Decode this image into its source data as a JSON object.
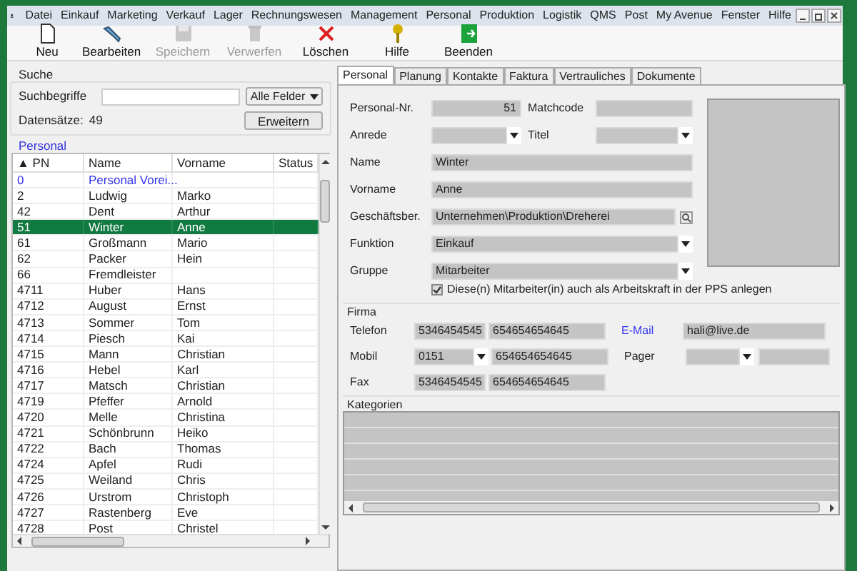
{
  "menu": [
    "Datei",
    "Einkauf",
    "Marketing",
    "Verkauf",
    "Lager",
    "Rechnungswesen",
    "Management",
    "Personal",
    "Produktion",
    "Logistik",
    "QMS",
    "Post",
    "My Avenue",
    "Fenster",
    "Hilfe"
  ],
  "toolbar": [
    {
      "label": "Neu",
      "kind": "new",
      "disabled": false
    },
    {
      "label": "Bearbeiten",
      "kind": "edit",
      "disabled": false
    },
    {
      "label": "Speichern",
      "kind": "save",
      "disabled": true
    },
    {
      "label": "Verwerfen",
      "kind": "discard",
      "disabled": true
    },
    {
      "label": "Löschen",
      "kind": "delete",
      "disabled": false
    },
    {
      "label": "Hilfe",
      "kind": "help",
      "disabled": false
    },
    {
      "label": "Beenden",
      "kind": "exit",
      "disabled": false
    }
  ],
  "search": {
    "title": "Suche",
    "label": "Suchbegriffe",
    "scope": "Alle Felder",
    "count_label": "Datensätze:",
    "count": "49",
    "button": "Erweitern"
  },
  "personal": {
    "title": "Personal",
    "columns": [
      "▲ PN",
      "Name",
      "Vorname",
      "Status"
    ],
    "rows": [
      {
        "cells": [
          "0",
          "Personal Vorei...",
          ""
        ],
        "kind": "template",
        "selected": false
      },
      {
        "cells": [
          "2",
          "Ludwig",
          "Marko"
        ],
        "kind": "person",
        "selected": false
      },
      {
        "cells": [
          "42",
          "Dent",
          "Arthur"
        ],
        "kind": "person",
        "selected": false
      },
      {
        "cells": [
          "51",
          "Winter",
          "Anne"
        ],
        "kind": "person",
        "selected": true
      },
      {
        "cells": [
          "61",
          "Großmann",
          "Mario"
        ],
        "kind": "person",
        "selected": false
      },
      {
        "cells": [
          "62",
          "Packer",
          "Hein"
        ],
        "kind": "person",
        "selected": false
      },
      {
        "cells": [
          "66",
          "Fremdleister",
          ""
        ],
        "kind": "person",
        "selected": false
      },
      {
        "cells": [
          "4711",
          "Huber",
          "Hans"
        ],
        "kind": "person",
        "selected": false
      },
      {
        "cells": [
          "4712",
          "August",
          "Ernst"
        ],
        "kind": "person",
        "selected": false
      },
      {
        "cells": [
          "4713",
          "Sommer",
          "Tom"
        ],
        "kind": "person",
        "selected": false
      },
      {
        "cells": [
          "4714",
          "Piesch",
          "Kai"
        ],
        "kind": "person",
        "selected": false
      },
      {
        "cells": [
          "4715",
          "Mann",
          "Christian"
        ],
        "kind": "person",
        "selected": false
      },
      {
        "cells": [
          "4716",
          "Hebel",
          "Karl"
        ],
        "kind": "person",
        "selected": false
      },
      {
        "cells": [
          "4717",
          "Matsch",
          "Christian"
        ],
        "kind": "person",
        "selected": false
      },
      {
        "cells": [
          "4719",
          "Pfeffer",
          "Arnold"
        ],
        "kind": "person",
        "selected": false
      },
      {
        "cells": [
          "4720",
          "Melle",
          "Christina"
        ],
        "kind": "person",
        "selected": false
      },
      {
        "cells": [
          "4721",
          "Schönbrunn",
          "Heiko"
        ],
        "kind": "person",
        "selected": false
      },
      {
        "cells": [
          "4722",
          "Bach",
          "Thomas"
        ],
        "kind": "person",
        "selected": false
      },
      {
        "cells": [
          "4724",
          "Apfel",
          "Rudi"
        ],
        "kind": "person",
        "selected": false
      },
      {
        "cells": [
          "4725",
          "Weiland",
          "Chris"
        ],
        "kind": "person",
        "selected": false
      },
      {
        "cells": [
          "4726",
          "Urstrom",
          "Christoph"
        ],
        "kind": "person",
        "selected": false
      },
      {
        "cells": [
          "4727",
          "Rastenberg",
          "Eve"
        ],
        "kind": "person",
        "selected": false
      },
      {
        "cells": [
          "4728",
          "Post",
          "Christel"
        ],
        "kind": "person",
        "selected": false
      }
    ]
  },
  "tabs": [
    {
      "label": "Personal",
      "selected": true
    },
    {
      "label": "Planung",
      "selected": false
    },
    {
      "label": "Kontakte",
      "selected": false
    },
    {
      "label": "Faktura",
      "selected": false
    },
    {
      "label": "Vertrauliches",
      "selected": false
    },
    {
      "label": "Dokumente",
      "selected": false
    }
  ],
  "form": {
    "personal_nr": {
      "label": "Personal-Nr.",
      "value": "51"
    },
    "matchcode": {
      "label": "Matchcode"
    },
    "anrede": {
      "label": "Anrede"
    },
    "titel": {
      "label": "Titel"
    },
    "name": {
      "label": "Name",
      "value": "Winter"
    },
    "vorname": {
      "label": "Vorname",
      "value": "Anne"
    },
    "geschaeftsbereich": {
      "label": "Geschäftsber.",
      "value": "Unternehmen\\Produktion\\Dreherei"
    },
    "funktion": {
      "label": "Funktion",
      "value": "Einkauf"
    },
    "gruppe": {
      "label": "Gruppe",
      "value": "Mitarbeiter"
    },
    "pps": {
      "label": "Diese(n) Mitarbeiter(in) auch als Arbeitskraft in der PPS anlegen",
      "checked": true
    }
  },
  "firma": {
    "title": "Firma",
    "telefon": {
      "label": "Telefon",
      "prefix": "5346454545",
      "number": "654654654645"
    },
    "email": {
      "label": "E-Mail",
      "value": "hali@live.de"
    },
    "mobil": {
      "label": "Mobil",
      "prefix": "0151",
      "number": "654654654645"
    },
    "pager": {
      "label": "Pager"
    },
    "fax": {
      "label": "Fax",
      "prefix": "5346454545",
      "number": "654654654645"
    }
  },
  "kategorien": {
    "title": "Kategorien"
  }
}
